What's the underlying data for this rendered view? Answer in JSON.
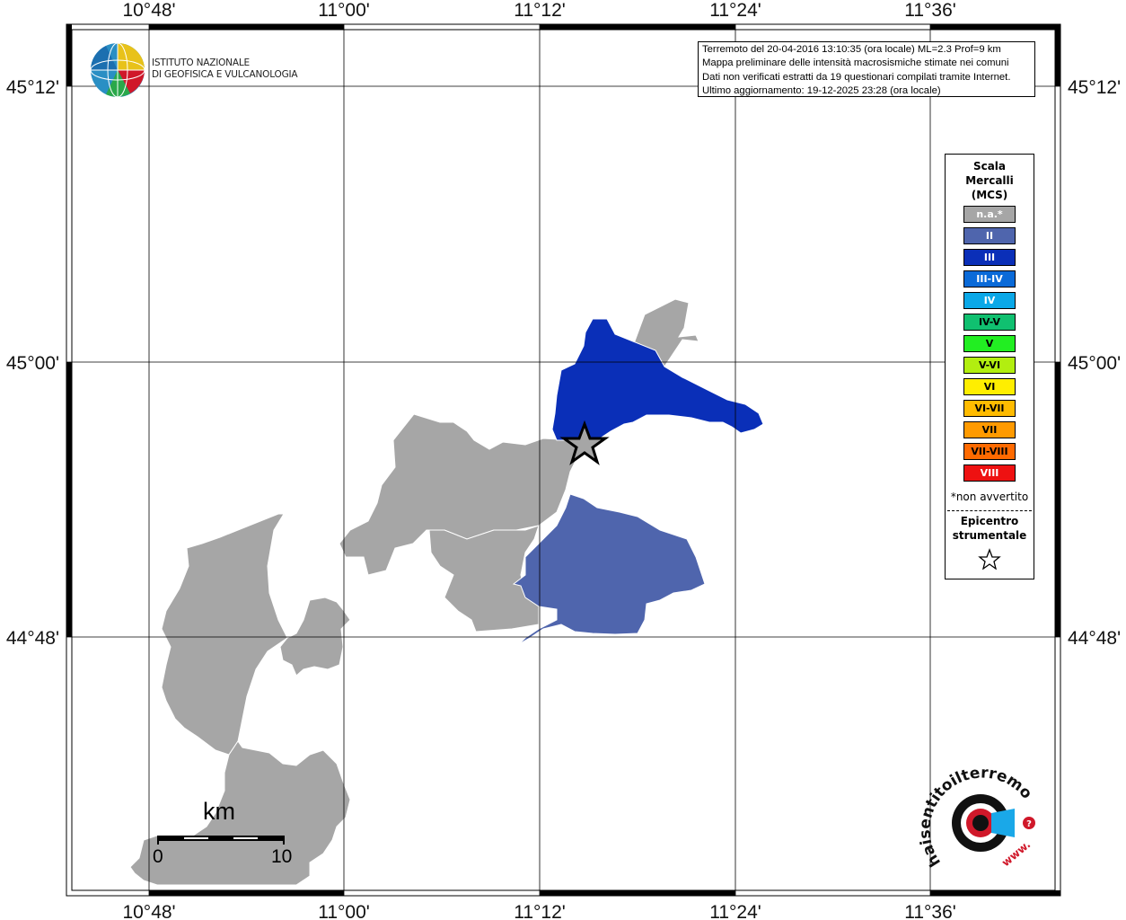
{
  "map": {
    "lon_ticks": [
      "10°48'",
      "11°00'",
      "11°12'",
      "11°24'",
      "11°36'"
    ],
    "lat_ticks": [
      "45°12'",
      "45°00'",
      "44°48'"
    ]
  },
  "header": {
    "institute_line1": "ISTITUTO NAZIONALE",
    "institute_line2": "DI GEOFISICA E VULCANOLOGIA"
  },
  "info": {
    "line1": "Terremoto del 20-04-2016 13:10:35 (ora locale) ML=2.3 Prof=9 km",
    "line2": "Mappa preliminare delle intensità macrosismiche stimate nei comuni",
    "line3": "Dati non verificati estratti da 19 questionari compilati tramite Internet.",
    "line4": "Ultimo aggiornamento: 19-12-2025 23:28 (ora locale)"
  },
  "legend": {
    "title_line1": "Scala",
    "title_line2": "Mercalli",
    "title_line3": "(MCS)",
    "items": [
      {
        "label": "n.a.*",
        "color": "#a6a6a6",
        "text_color": "#ffffff"
      },
      {
        "label": "II",
        "color": "#4f65ad",
        "text_color": "#ffffff"
      },
      {
        "label": "III",
        "color": "#0a2fb8",
        "text_color": "#ffffff"
      },
      {
        "label": "III-IV",
        "color": "#0a6ad8",
        "text_color": "#ffffff"
      },
      {
        "label": "IV",
        "color": "#0aa8e8",
        "text_color": "#ffffff"
      },
      {
        "label": "IV-V",
        "color": "#10c070",
        "text_color": "#000000"
      },
      {
        "label": "V",
        "color": "#22ee22",
        "text_color": "#000000"
      },
      {
        "label": "V-VI",
        "color": "#b2ee10",
        "text_color": "#000000"
      },
      {
        "label": "VI",
        "color": "#ffee00",
        "text_color": "#000000"
      },
      {
        "label": "VI-VII",
        "color": "#ffbb00",
        "text_color": "#000000"
      },
      {
        "label": "VII",
        "color": "#ff9a00",
        "text_color": "#000000"
      },
      {
        "label": "VII-VIII",
        "color": "#ff6a00",
        "text_color": "#000000"
      },
      {
        "label": "VIII",
        "color": "#ee1111",
        "text_color": "#ffffff"
      }
    ],
    "note": "*non avvertito",
    "epicenter_line1": "Epicentro",
    "epicenter_line2": "strumentale"
  },
  "scale_bar": {
    "unit": "km",
    "start": "0",
    "end": "10"
  },
  "logo": {
    "text": "haisentitoilterremoto.it",
    "www": "www."
  },
  "colors": {
    "na": "#a6a6a6",
    "II": "#4f65ad",
    "III": "#0a2fb8"
  }
}
